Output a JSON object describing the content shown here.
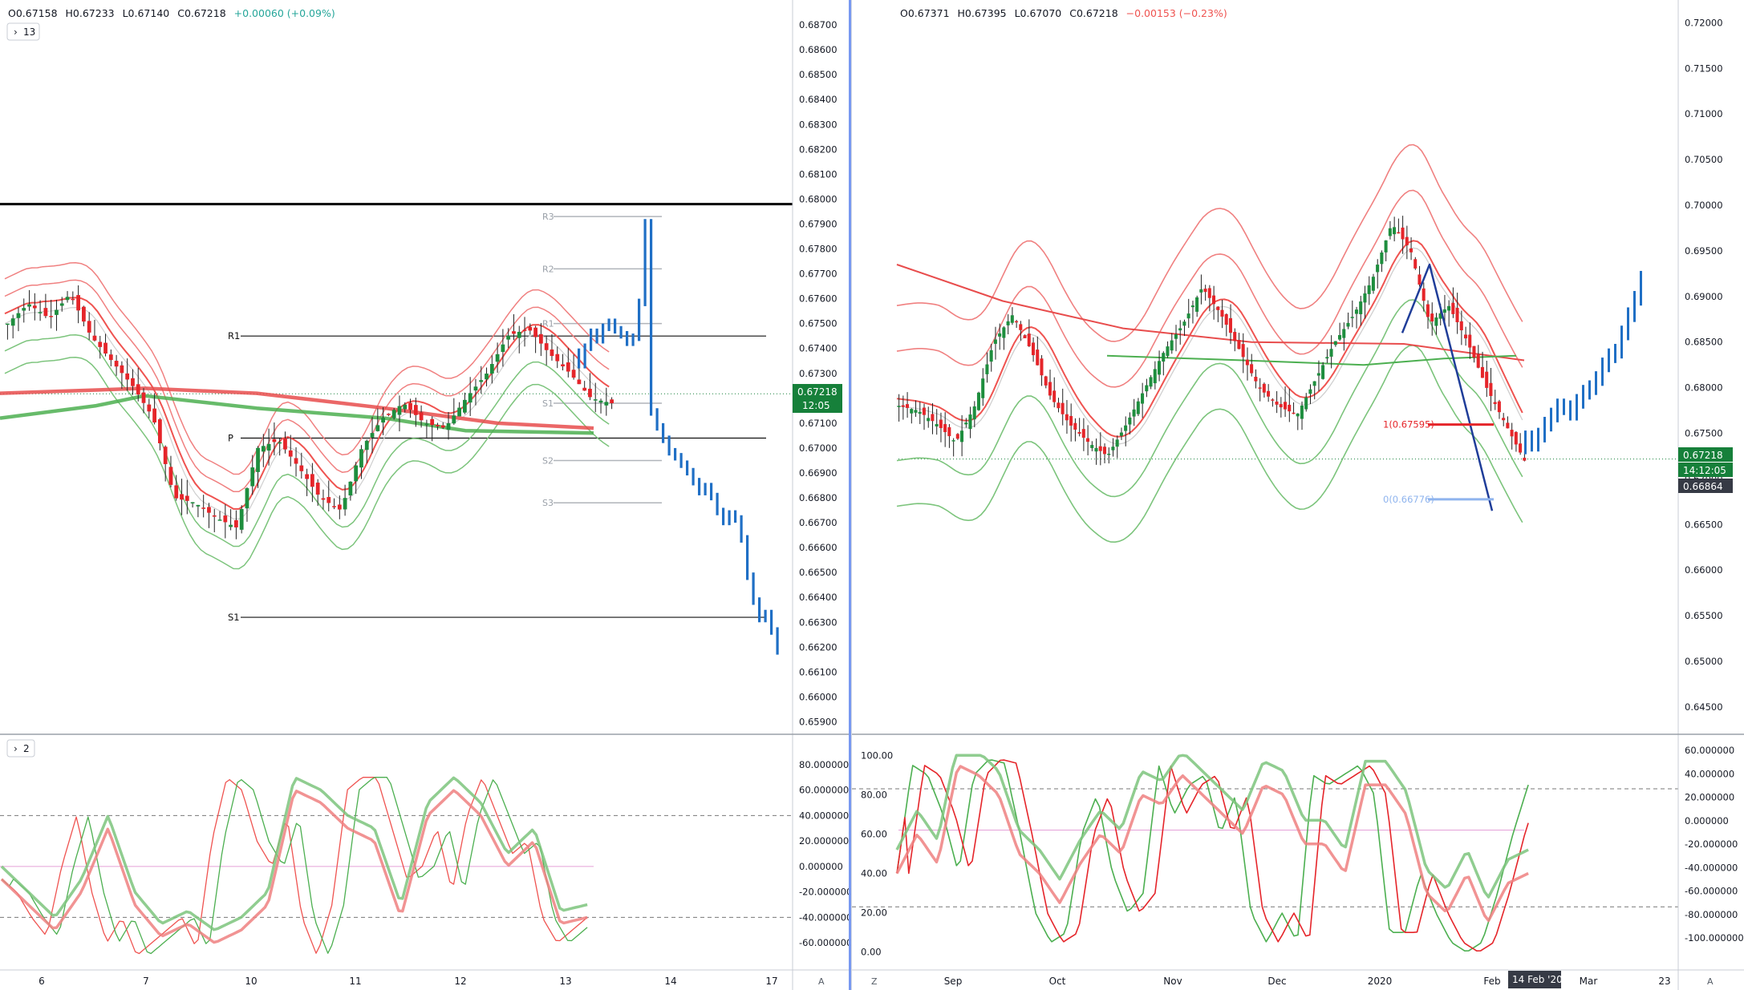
{
  "left_panel": {
    "ohlc": {
      "open": "O0.67158",
      "high": "H0.67233",
      "low": "L0.67140",
      "close": "C0.67218",
      "change": "+0.00060 (+0.09%)"
    },
    "collapse_main": "13",
    "collapse_osc": "2",
    "price_badge": "0.67218",
    "time_badge": "12:05",
    "corner_button": "A"
  },
  "right_panel": {
    "ohlc": {
      "open": "O0.67371",
      "high": "H0.67395",
      "low": "L0.67070",
      "close": "C0.67218",
      "change": "−0.00153 (−0.23%)"
    },
    "price_badge": "0.67218",
    "time_badge": "14:12:05",
    "crosshair_badge": "0.66864",
    "date_badge": "14 Feb '20",
    "left_corner_button": "Z",
    "corner_button": "A"
  },
  "chart_data": [
    {
      "type": "candlestick",
      "name": "left-price",
      "y_ticks": [
        "0.68700",
        "0.68600",
        "0.68500",
        "0.68400",
        "0.68300",
        "0.68200",
        "0.68100",
        "0.68000",
        "0.67900",
        "0.67800",
        "0.67700",
        "0.67600",
        "0.67500",
        "0.67400",
        "0.67300",
        "0.67200",
        "0.67100",
        "0.67000",
        "0.66900",
        "0.66800",
        "0.66700",
        "0.66600",
        "0.66500",
        "0.66400",
        "0.66300",
        "0.66200",
        "0.66100",
        "0.66000",
        "0.65900"
      ],
      "x_ticks": [
        "6",
        "7",
        "10",
        "11",
        "12",
        "13",
        "14",
        "17"
      ],
      "ylim": [
        0.6585,
        0.688
      ],
      "pivots": [
        {
          "label": "R3",
          "value": 0.6793
        },
        {
          "label": "R2",
          "value": 0.6772
        },
        {
          "label": "R1",
          "value": 0.675
        },
        {
          "label": "P",
          "value": 0.6704
        },
        {
          "label": "S1",
          "value": 0.6718
        },
        {
          "label": "S2",
          "value": 0.6695
        },
        {
          "label": "S3",
          "value": 0.6678
        }
      ],
      "level_labels": [
        {
          "label": "R1",
          "value": 0.6745
        },
        {
          "label": "P",
          "value": 0.6704
        },
        {
          "label": "S1",
          "value": 0.6632
        }
      ],
      "black_line": 0.6798,
      "last_price": 0.67218,
      "projection": [
        0.6735,
        0.6742,
        0.6748,
        0.6745,
        0.675,
        0.6752,
        0.6749,
        0.6747,
        0.6744,
        0.6746,
        0.676,
        0.6792,
        0.6716,
        0.671,
        0.6705,
        0.67,
        0.6698,
        0.6695,
        0.6692,
        0.6688,
        0.6684,
        0.6686,
        0.6682,
        0.6676,
        0.6672,
        0.6675,
        0.6673,
        0.6665,
        0.665,
        0.664,
        0.6633,
        0.6635,
        0.6628,
        0.662
      ]
    },
    {
      "type": "candlestick",
      "name": "right-price",
      "y_ticks": [
        "0.72000",
        "0.71500",
        "0.71000",
        "0.70500",
        "0.70000",
        "0.69500",
        "0.69000",
        "0.68500",
        "0.68000",
        "0.67500",
        "0.67000",
        "0.66500",
        "0.66000",
        "0.65500",
        "0.65000",
        "0.64500"
      ],
      "x_ticks": [
        "Sep",
        "Oct",
        "Nov",
        "Dec",
        "2020",
        "Feb",
        "Mar",
        "23"
      ],
      "ylim": [
        0.642,
        0.7225
      ],
      "fib_labels": [
        {
          "label": "1(0.67595)",
          "value": 0.67595
        },
        {
          "label": "0(0.66776)",
          "value": 0.66776
        }
      ],
      "last_price": 0.67218,
      "projection": [
        0.6745,
        0.6738,
        0.6748,
        0.676,
        0.677,
        0.678,
        0.6778,
        0.6772,
        0.6785,
        0.6795,
        0.68,
        0.681,
        0.6825,
        0.6835,
        0.684,
        0.686,
        0.688,
        0.6898,
        0.692
      ]
    },
    {
      "type": "line",
      "name": "left-oscillator",
      "y_ticks": [
        "80.000000",
        "60.000000",
        "40.000000",
        "20.000000",
        "0.000000",
        "-20.000000",
        "-40.000000",
        "-60.000000"
      ],
      "ylim": [
        -75,
        95
      ],
      "overbought": 40,
      "oversold": -40
    },
    {
      "type": "line",
      "name": "right-oscillator",
      "y_ticks_left": [
        "100.00",
        "80.00",
        "60.00",
        "40.00",
        "20.00",
        "0.00"
      ],
      "y_ticks_right": [
        "60.000000",
        "40.000000",
        "20.000000",
        "0.000000",
        "-20.000000",
        "-40.000000",
        "-60.000000",
        "-80.000000",
        "-100.000000"
      ],
      "ylim": [
        -5,
        105
      ]
    }
  ]
}
